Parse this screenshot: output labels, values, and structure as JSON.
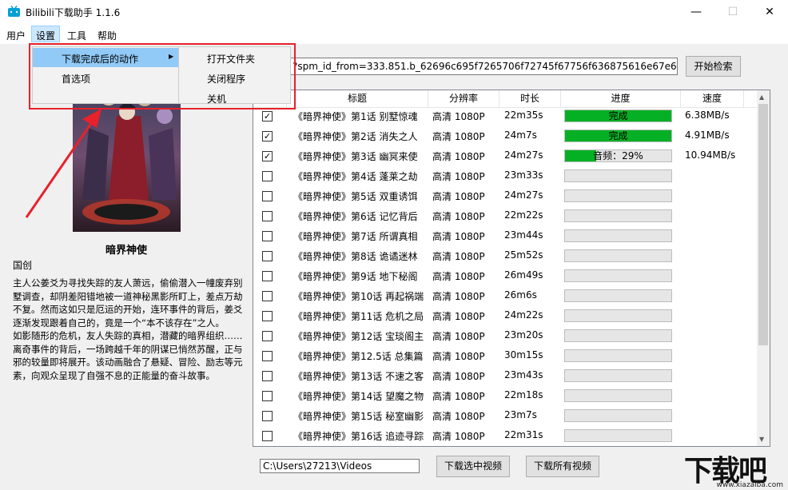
{
  "window": {
    "title": "Bilibili下载助手 1.1.6",
    "controls": {
      "minimize": "—",
      "maximize": "☐",
      "close": "✕"
    }
  },
  "menubar": {
    "items": [
      "用户",
      "设置",
      "工具",
      "帮助"
    ]
  },
  "settings_menu": {
    "items": [
      "下载完成后的动作",
      "首选项"
    ],
    "submenu": [
      "打开文件夹",
      "关闭程序",
      "关机"
    ]
  },
  "url_field": {
    "value": "?spm_id_from=333.851.b_62696c695f7265706f72745f67756f636875616e67e67.7"
  },
  "search_button": "开始检索",
  "anime": {
    "title": "暗界神使",
    "region": "国创",
    "description": "主人公姜爻为寻找失踪的友人萧远，偷偷潜入一幢废弃别墅调查，却阴差阳错地被一道神秘黑影所盯上，差点万劫不复。然而这如只是厄运的开始，连环事件的背后，姜爻逐渐发现跟着自己的，竟是一个“本不该存在”之人。\n如影随形的危机，友人失踪的真相，潜藏的暗界组织……离奇事件的背后，一场跨越千年的阴谋已悄然苏醒，正与邪的较量即将展开。该动画融合了悬疑、冒险、励志等元素，向观众呈现了自强不息的正能量的奋斗故事。"
  },
  "table": {
    "headers": [
      "标题",
      "分辨率",
      "时长",
      "进度",
      "速度"
    ],
    "rows": [
      {
        "checked": true,
        "title": "《暗界神使》第1话 别墅惊魂",
        "res": "高清 1080P",
        "dur": "22m35s",
        "progress": 1.0,
        "progress_text": "完成",
        "speed": "6.38MB/s"
      },
      {
        "checked": true,
        "title": "《暗界神使》第2话 消失之人",
        "res": "高清 1080P",
        "dur": "24m7s",
        "progress": 1.0,
        "progress_text": "完成",
        "speed": "4.91MB/s"
      },
      {
        "checked": true,
        "title": "《暗界神使》第3话 幽冥来使",
        "res": "高清 1080P",
        "dur": "24m27s",
        "progress": 0.29,
        "progress_text": "音频：29%",
        "speed": "10.94MB/s"
      },
      {
        "checked": false,
        "title": "《暗界神使》第4话 蓬莱之劫",
        "res": "高清 1080P",
        "dur": "23m33s",
        "progress": 0,
        "progress_text": "",
        "speed": ""
      },
      {
        "checked": false,
        "title": "《暗界神使》第5话 双重诱饵",
        "res": "高清 1080P",
        "dur": "24m27s",
        "progress": 0,
        "progress_text": "",
        "speed": ""
      },
      {
        "checked": false,
        "title": "《暗界神使》第6话 记忆背后",
        "res": "高清 1080P",
        "dur": "22m22s",
        "progress": 0,
        "progress_text": "",
        "speed": ""
      },
      {
        "checked": false,
        "title": "《暗界神使》第7话 所谓真相",
        "res": "高清 1080P",
        "dur": "23m44s",
        "progress": 0,
        "progress_text": "",
        "speed": ""
      },
      {
        "checked": false,
        "title": "《暗界神使》第8话 诡谲迷林",
        "res": "高清 1080P",
        "dur": "25m52s",
        "progress": 0,
        "progress_text": "",
        "speed": ""
      },
      {
        "checked": false,
        "title": "《暗界神使》第9话 地下秘阁",
        "res": "高清 1080P",
        "dur": "26m49s",
        "progress": 0,
        "progress_text": "",
        "speed": ""
      },
      {
        "checked": false,
        "title": "《暗界神使》第10话 再起祸端",
        "res": "高清 1080P",
        "dur": "26m6s",
        "progress": 0,
        "progress_text": "",
        "speed": ""
      },
      {
        "checked": false,
        "title": "《暗界神使》第11话 危机之局",
        "res": "高清 1080P",
        "dur": "24m22s",
        "progress": 0,
        "progress_text": "",
        "speed": ""
      },
      {
        "checked": false,
        "title": "《暗界神使》第12话 宝琰阁主",
        "res": "高清 1080P",
        "dur": "23m20s",
        "progress": 0,
        "progress_text": "",
        "speed": ""
      },
      {
        "checked": false,
        "title": "《暗界神使》第12.5话 总集篇",
        "res": "高清 1080P",
        "dur": "30m15s",
        "progress": 0,
        "progress_text": "",
        "speed": ""
      },
      {
        "checked": false,
        "title": "《暗界神使》第13话 不速之客",
        "res": "高清 1080P",
        "dur": "23m43s",
        "progress": 0,
        "progress_text": "",
        "speed": ""
      },
      {
        "checked": false,
        "title": "《暗界神使》第14话 望魔之物",
        "res": "高清 1080P",
        "dur": "22m18s",
        "progress": 0,
        "progress_text": "",
        "speed": ""
      },
      {
        "checked": false,
        "title": "《暗界神使》第15话 秘室幽影",
        "res": "高清 1080P",
        "dur": "23m7s",
        "progress": 0,
        "progress_text": "",
        "speed": ""
      },
      {
        "checked": false,
        "title": "《暗界神使》第16话 追迹寻踪",
        "res": "高清 1080P",
        "dur": "22m31s",
        "progress": 0,
        "progress_text": "",
        "speed": ""
      }
    ]
  },
  "bottom": {
    "path": "C:\\Users\\27213\\Videos",
    "download_selected": "下载选中视频",
    "download_all": "下载所有视频"
  },
  "watermark": {
    "logo": "下载吧",
    "url": "www.xiazaiba.com"
  },
  "colors": {
    "progress": "#06b025",
    "highlight": "#91c9f7",
    "annotation": "#e8212b"
  }
}
